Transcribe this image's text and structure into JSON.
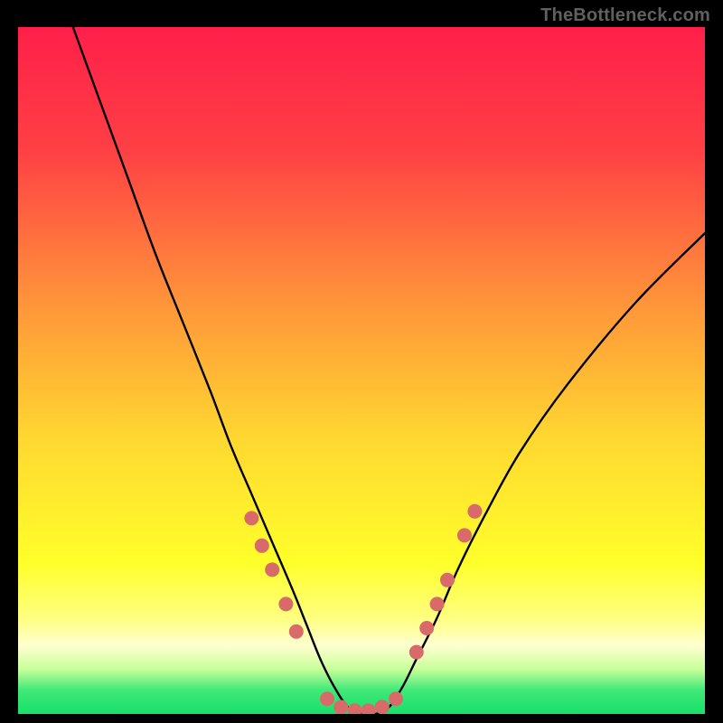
{
  "watermark": {
    "text": "TheBottleneck.com"
  },
  "chart_data": {
    "type": "line",
    "title": "",
    "xlabel": "",
    "ylabel": "",
    "xlim": [
      0,
      100
    ],
    "ylim": [
      0,
      100
    ],
    "grid": false,
    "legend": false,
    "background_gradient": {
      "stops": [
        {
          "offset": 0.0,
          "color": "#ff1f4a"
        },
        {
          "offset": 0.18,
          "color": "#ff4044"
        },
        {
          "offset": 0.4,
          "color": "#ff943a"
        },
        {
          "offset": 0.6,
          "color": "#ffd830"
        },
        {
          "offset": 0.78,
          "color": "#ffff2a"
        },
        {
          "offset": 0.86,
          "color": "#ffff80"
        },
        {
          "offset": 0.9,
          "color": "#ffffd0"
        },
        {
          "offset": 0.935,
          "color": "#c8ff9a"
        },
        {
          "offset": 0.965,
          "color": "#40e978"
        },
        {
          "offset": 1.0,
          "color": "#17e06a"
        }
      ]
    },
    "series": [
      {
        "name": "bottleneck-curve",
        "note": "V-shaped curve; y is bottleneck percentage (100=top, 0=bottom). Values estimated from gridless plot.",
        "x": [
          8,
          12,
          16,
          20,
          24,
          28,
          31,
          34,
          37,
          40,
          42,
          44,
          46,
          48,
          50,
          52,
          54,
          56,
          58,
          61,
          64,
          68,
          73,
          80,
          90,
          100
        ],
        "y": [
          100,
          89,
          78,
          67,
          57,
          47,
          39,
          32,
          25,
          18,
          13,
          8,
          4,
          1,
          0,
          0,
          1,
          4,
          8,
          14,
          21,
          29,
          38,
          48,
          60,
          70
        ]
      }
    ],
    "markers": {
      "color": "#d86a6a",
      "note": "Pink dots near the curve trough; coordinates are approximate in chart space.",
      "points": [
        {
          "x": 34.0,
          "y": 28.5
        },
        {
          "x": 35.5,
          "y": 24.5
        },
        {
          "x": 37.0,
          "y": 21.0
        },
        {
          "x": 39.0,
          "y": 16.0
        },
        {
          "x": 40.5,
          "y": 12.0
        },
        {
          "x": 45.0,
          "y": 2.2
        },
        {
          "x": 47.0,
          "y": 1.0
        },
        {
          "x": 49.0,
          "y": 0.5
        },
        {
          "x": 51.0,
          "y": 0.5
        },
        {
          "x": 53.0,
          "y": 1.0
        },
        {
          "x": 55.0,
          "y": 2.2
        },
        {
          "x": 58.0,
          "y": 9.0
        },
        {
          "x": 59.5,
          "y": 12.5
        },
        {
          "x": 61.0,
          "y": 16.0
        },
        {
          "x": 62.5,
          "y": 19.5
        },
        {
          "x": 65.0,
          "y": 26.0
        },
        {
          "x": 66.5,
          "y": 29.5
        }
      ]
    }
  }
}
